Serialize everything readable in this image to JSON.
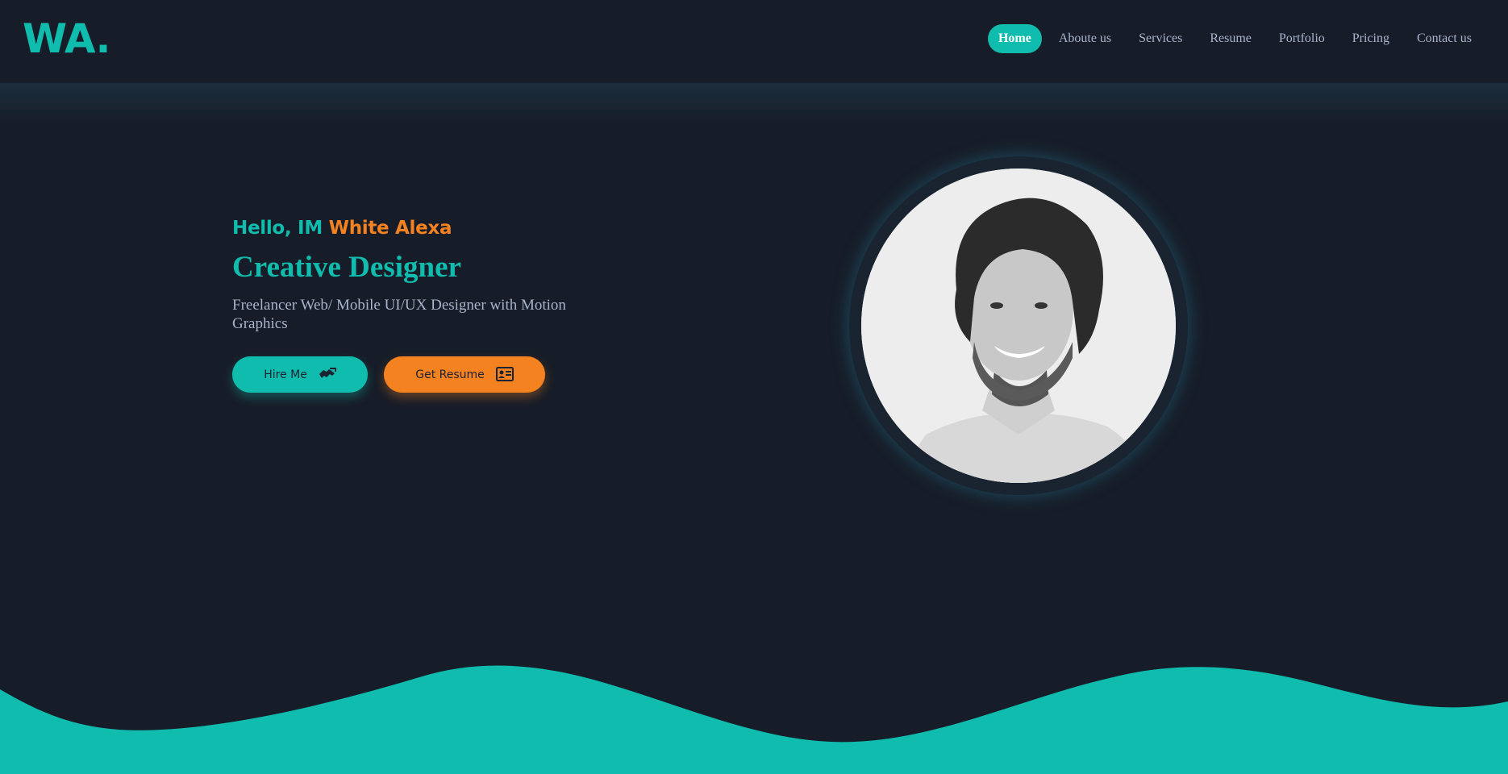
{
  "header": {
    "logo": "WA.",
    "nav": [
      {
        "label": "Home",
        "active": true
      },
      {
        "label": "Aboute us",
        "active": false
      },
      {
        "label": "Services",
        "active": false
      },
      {
        "label": "Resume",
        "active": false
      },
      {
        "label": "Portfolio",
        "active": false
      },
      {
        "label": "Pricing",
        "active": false
      },
      {
        "label": "Contact us",
        "active": false
      }
    ]
  },
  "hero": {
    "greeting_prefix": "Hello, IM ",
    "greeting_name": "White Alexa",
    "role": "Creative Designer",
    "tagline": "Freelancer Web/ Mobile UI/UX Designer with Motion Graphics",
    "hire_button": "Hire Me",
    "hire_icon": "handshake-icon",
    "resume_button": "Get Resume",
    "resume_icon": "id-card-icon"
  },
  "portrait": {
    "subject": "portrait-photo"
  },
  "colors": {
    "background": "#171d28",
    "accent_teal": "#0fbcad",
    "accent_orange": "#f58220",
    "nav_text": "#a9b4cc"
  }
}
